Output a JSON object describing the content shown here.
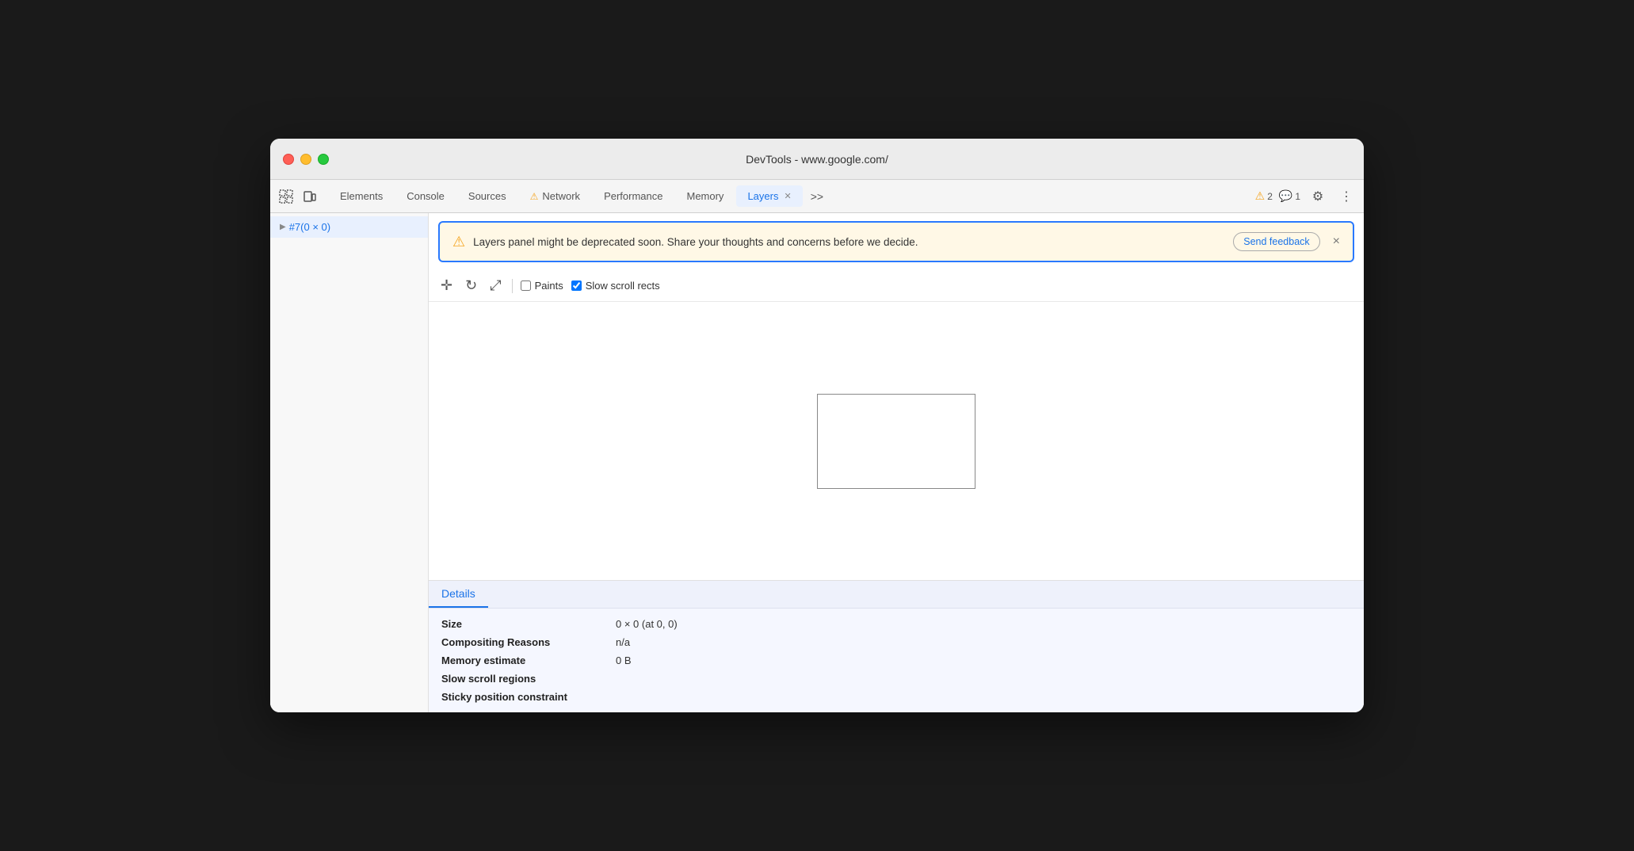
{
  "window": {
    "title": "DevTools - www.google.com/"
  },
  "tabs": [
    {
      "id": "elements",
      "label": "Elements",
      "active": false,
      "warning": false
    },
    {
      "id": "console",
      "label": "Console",
      "active": false,
      "warning": false
    },
    {
      "id": "sources",
      "label": "Sources",
      "active": false,
      "warning": false
    },
    {
      "id": "network",
      "label": "Network",
      "active": false,
      "warning": true
    },
    {
      "id": "performance",
      "label": "Performance",
      "active": false,
      "warning": false
    },
    {
      "id": "memory",
      "label": "Memory",
      "active": false,
      "warning": false
    },
    {
      "id": "layers",
      "label": "Layers",
      "active": true,
      "warning": false
    }
  ],
  "tab_more": ">>",
  "toolbar_right": {
    "warnings_count": "2",
    "messages_count": "1"
  },
  "sidebar": {
    "items": [
      {
        "id": "layer1",
        "label": "#7(0 × 0)",
        "active": true
      }
    ]
  },
  "warning_banner": {
    "message": "Layers panel might be deprecated soon. Share your thoughts and concerns before we decide.",
    "button_label": "Send feedback",
    "close_symbol": "×"
  },
  "toolbar": {
    "paints_label": "Paints",
    "slow_scroll_label": "Slow scroll rects",
    "paints_checked": false,
    "slow_scroll_checked": true
  },
  "details": {
    "tab_label": "Details",
    "rows": [
      {
        "label": "Size",
        "value": "0 × 0 (at 0, 0)"
      },
      {
        "label": "Compositing Reasons",
        "value": "n/a"
      },
      {
        "label": "Memory estimate",
        "value": "0 B"
      },
      {
        "label": "Slow scroll regions",
        "value": ""
      },
      {
        "label": "Sticky position constraint",
        "value": ""
      }
    ]
  }
}
